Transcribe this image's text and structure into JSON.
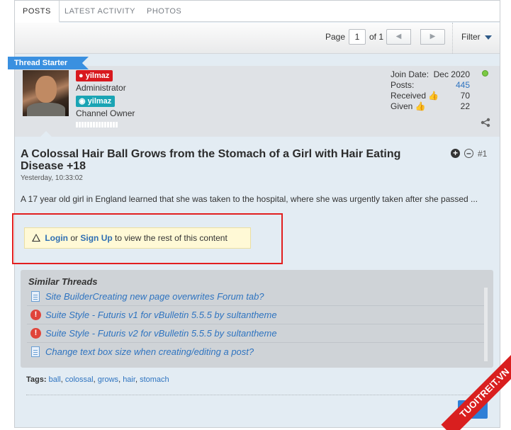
{
  "tabs": [
    {
      "label": "POSTS",
      "active": true
    },
    {
      "label": "LATEST ACTIVITY",
      "active": false
    },
    {
      "label": "PHOTOS",
      "active": false
    }
  ],
  "pagination": {
    "page_label": "Page",
    "page_value": "1",
    "of_label": "of 1",
    "prev_icon": "chevron-left-icon",
    "next_icon": "chevron-right-icon"
  },
  "filter_label": "Filter",
  "ribbon": "Thread Starter",
  "user": {
    "name": "yilmaz",
    "badge_color": "#d8191e",
    "role1": "Administrator",
    "badge2_name": "yilmaz",
    "badge2_color": "#1aa4b4",
    "role2": "Channel Owner",
    "stats": {
      "join_label": "Join Date:",
      "join_value": "Dec 2020",
      "posts_label": "Posts:",
      "posts_value": "445",
      "received_label": "Received",
      "received_value": "70",
      "given_label": "Given",
      "given_value": "22"
    },
    "online_color": "#7ac943"
  },
  "post": {
    "title": "A Colossal Hair Ball Grows from the Stomach of a Girl with Hair Eating Disease +18",
    "date": "Yesterday, 10:33:02",
    "number": "#1",
    "body": "A 17 year old girl in England learned that she was taken to the hospital, where she was urgently taken after she passed ..."
  },
  "notice": {
    "login": "Login",
    "or": "or",
    "signup": "Sign Up",
    "rest": "to view the rest of this content"
  },
  "similar": {
    "title": "Similar Threads",
    "items": [
      {
        "icon": "document-icon",
        "text": "Site BuilderCreating new page overwrites Forum tab?"
      },
      {
        "icon": "alert-icon",
        "text": "Suite Style - Futuris v1 for vBulletin 5.5.5 by sultantheme"
      },
      {
        "icon": "alert-icon",
        "text": "Suite Style - Futuris v2 for vBulletin 5.5.5 by sultantheme"
      },
      {
        "icon": "document-icon",
        "text": "Change text box size when creating/editing a post?"
      }
    ]
  },
  "tags": {
    "label": "Tags:",
    "items": [
      "ball",
      "colossal",
      "grows",
      "hair",
      "stomach"
    ]
  },
  "watermark": "TUOITREIT.VN",
  "colors": {
    "accent": "#2f74c0",
    "highlight_border": "#e21f1f",
    "ribbon": "#3a90e0"
  }
}
